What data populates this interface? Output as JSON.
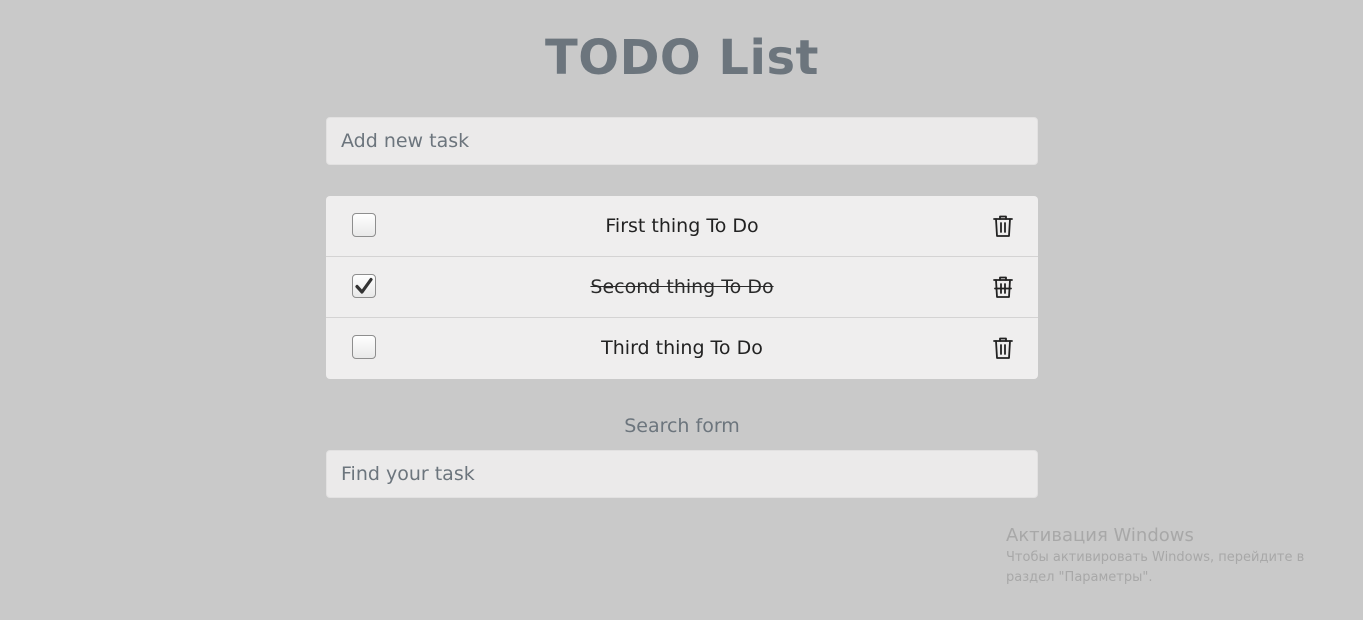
{
  "header": {
    "title": "TODO List"
  },
  "add_task": {
    "placeholder": "Add new task"
  },
  "tasks": [
    {
      "text": "First thing To Do",
      "done": false
    },
    {
      "text": "Second thing To Do",
      "done": true
    },
    {
      "text": "Third thing To Do",
      "done": false
    }
  ],
  "search": {
    "label": "Search form",
    "placeholder": "Find your task"
  },
  "icons": {
    "checkbox_check": "check-icon",
    "delete": "trash-icon"
  },
  "colors": {
    "background": "#c9c9c9",
    "title": "#6c757d",
    "input_bg": "#ebeaea",
    "list_bg": "#efeeee"
  },
  "windows_activation": {
    "title": "Активация Windows",
    "line1": "Чтобы активировать Windows, перейдите в",
    "line2": "раздел \"Параметры\"."
  }
}
